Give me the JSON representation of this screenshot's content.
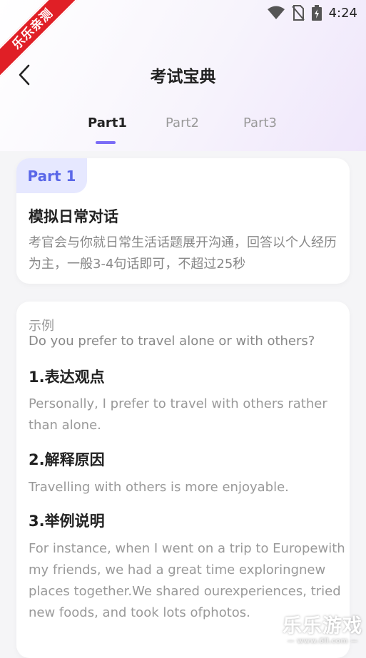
{
  "status": {
    "time": "4:24"
  },
  "watermark": {
    "ribbon": "乐乐亲测",
    "brand": "乐乐游戏",
    "url": "— www.6ll.com —"
  },
  "nav": {
    "title": "考试宝典"
  },
  "tabs": [
    {
      "label": "Part1",
      "active": true
    },
    {
      "label": "Part2",
      "active": false
    },
    {
      "label": "Part3",
      "active": false
    }
  ],
  "intro_card": {
    "badge": "Part 1",
    "title": "模拟日常对话",
    "description": "考官会与你就日常生活话题展开沟通，回答以个人经历为主，一般3-4句话即可，不超过25秒"
  },
  "example_card": {
    "label": "示例",
    "question": "Do you prefer to travel alone or with others?",
    "sections": [
      {
        "title": "1.表达观点",
        "body": "Personally, I prefer to travel with others rather than alone."
      },
      {
        "title": "2.解释原因",
        "body": "Travelling with others is more enjoyable."
      },
      {
        "title": "3.举例说明",
        "body": "For instance, when I went on a trip to Europewith my friends, we had a great time exploringnew places together.We shared ourexperiences, tried new foods, and took lots ofphotos."
      }
    ]
  },
  "colors": {
    "accent": "#7b6cf6",
    "badge_bg": "#e6e8ff",
    "badge_text": "#5a67e8",
    "ribbon": "#e01f26"
  }
}
